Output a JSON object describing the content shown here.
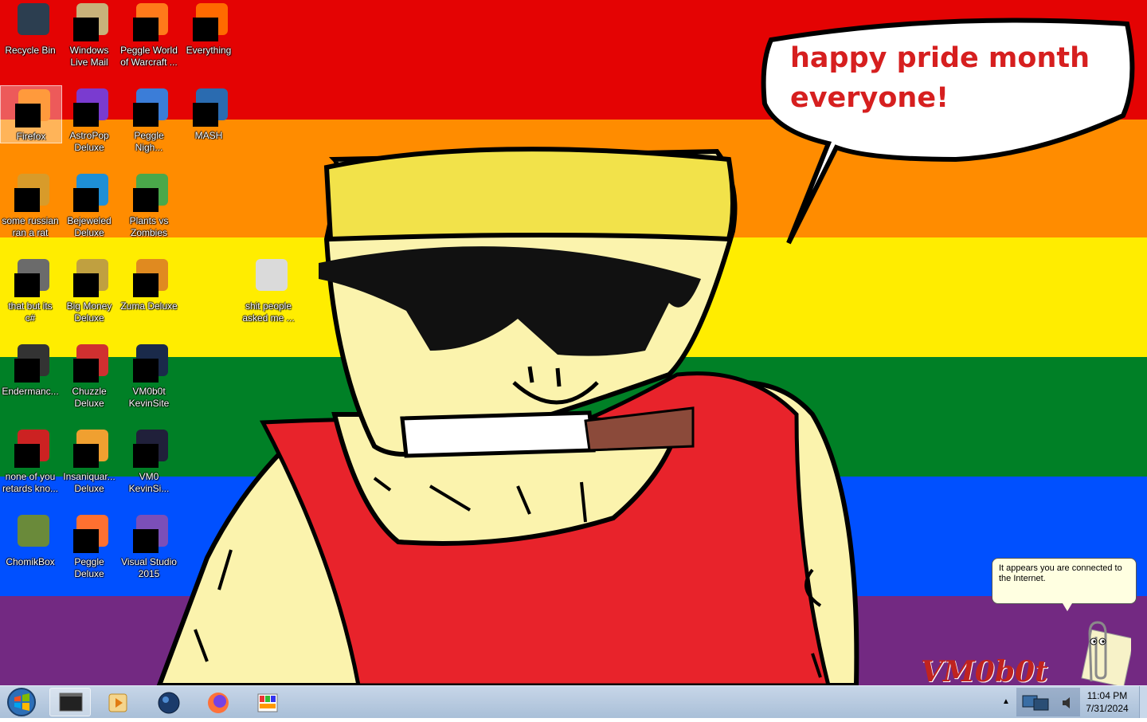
{
  "wallpaper": {
    "stripe_colors": [
      "#e40303",
      "#ff8c00",
      "#ffed00",
      "#008026",
      "#0050ff",
      "#732982"
    ],
    "speech_bubble": {
      "line1": "happy pride month",
      "line2": "everyone!"
    },
    "signature": "VM0b0t"
  },
  "desktop": {
    "icons": [
      {
        "label": "Recycle Bin",
        "icon": "recycle-bin-icon"
      },
      {
        "label": "Windows\nLive Mail",
        "icon": "mail-icon"
      },
      {
        "label": "Peggle World\nof Warcraft ...",
        "icon": "peggle-icon"
      },
      {
        "label": "Everything",
        "icon": "search-icon"
      },
      {
        "label": "Firefox",
        "icon": "firefox-icon"
      },
      {
        "label": "AstroPop\nDeluxe",
        "icon": "game-icon"
      },
      {
        "label": "Peggle\nNigh...",
        "icon": "peggle-icon"
      },
      {
        "label": "MASH",
        "icon": "game-icon"
      },
      {
        "label": "some russian\nran a rat",
        "icon": "app-icon"
      },
      {
        "label": "Bejeweled\nDeluxe",
        "icon": "game-icon"
      },
      {
        "label": "Plants vs\nZombies",
        "icon": "game-icon"
      },
      {
        "label": "that but its\nc#",
        "icon": "window-icon"
      },
      {
        "label": "Big Money\nDeluxe",
        "icon": "game-icon"
      },
      {
        "label": "Zuma Deluxe",
        "icon": "game-icon"
      },
      {
        "label": "shit people\nasked me ...",
        "icon": "folder-icon"
      },
      {
        "label": "Endermanc...",
        "icon": "app-icon"
      },
      {
        "label": "Chuzzle\nDeluxe",
        "icon": "game-icon"
      },
      {
        "label": "VM0b0t\nKevinSite",
        "icon": "app-icon"
      },
      {
        "label": "none of you\nretards kno...",
        "icon": "app-icon"
      },
      {
        "label": "Insaniquar...\nDeluxe",
        "icon": "game-icon"
      },
      {
        "label": "VM0\nKevinSi...",
        "icon": "app-icon"
      },
      {
        "label": "ChomikBox",
        "icon": "hamster-icon"
      },
      {
        "label": "Peggle\nDeluxe",
        "icon": "peggle-icon"
      },
      {
        "label": "Visual Studio\n2015",
        "icon": "visual-studio-icon"
      }
    ]
  },
  "tooltip": {
    "text": "It appears you are connected to the Internet."
  },
  "taskbar": {
    "time": "11:04 PM",
    "date": "7/31/2024",
    "pinned": [
      "cmd-icon",
      "media-player-icon",
      "globe-icon",
      "firefox-icon",
      "paint-icon"
    ]
  }
}
